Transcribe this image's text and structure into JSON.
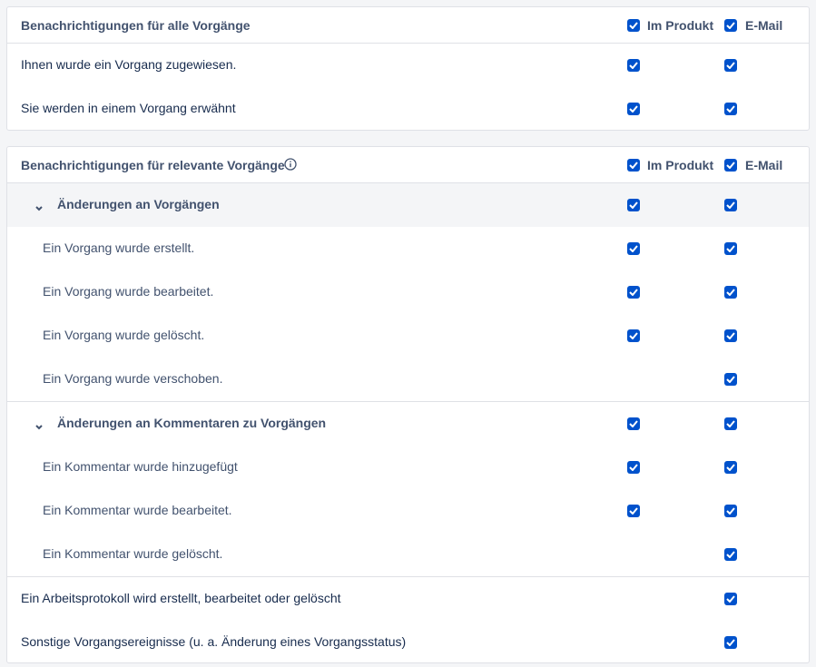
{
  "colors": {
    "accent": "#0052cc",
    "border": "#dfe1e6",
    "group_bg": "#f4f5f7"
  },
  "all_issues": {
    "title": "Benachrichtigungen für alle Vorgänge",
    "col_product": "Im Produkt",
    "col_email": "E-Mail",
    "rows": [
      {
        "label": "Ihnen wurde ein Vorgang zugewiesen.",
        "product": true,
        "email": true
      },
      {
        "label": "Sie werden in einem Vorgang erwähnt",
        "product": true,
        "email": true
      }
    ]
  },
  "relevant_issues": {
    "title": "Benachrichtigungen für relevante Vorgänge",
    "info_icon": "info-icon",
    "col_product": "Im Produkt",
    "col_email": "E-Mail",
    "groups": [
      {
        "label": "Änderungen an Vorgängen",
        "product": true,
        "email": true,
        "rows": [
          {
            "label": "Ein Vorgang wurde erstellt.",
            "product": true,
            "email": true
          },
          {
            "label": "Ein Vorgang wurde bearbeitet.",
            "product": true,
            "email": true
          },
          {
            "label": "Ein Vorgang wurde gelöscht.",
            "product": true,
            "email": true
          },
          {
            "label": "Ein Vorgang wurde verschoben.",
            "product": false,
            "email": true
          }
        ]
      },
      {
        "label": "Änderungen an Kommentaren zu Vorgängen",
        "product": true,
        "email": true,
        "rows": [
          {
            "label": "Ein Kommentar wurde hinzugefügt",
            "product": true,
            "email": true
          },
          {
            "label": "Ein Kommentar wurde bearbeitet.",
            "product": true,
            "email": true
          },
          {
            "label": "Ein Kommentar wurde gelöscht.",
            "product": false,
            "email": true
          }
        ]
      }
    ],
    "other_rows": [
      {
        "label": "Ein Arbeitsprotokoll wird erstellt, bearbeitet oder gelöscht",
        "product": false,
        "email": true
      },
      {
        "label": "Sonstige Vorgangsereignisse (u. a. Änderung eines Vorgangsstatus)",
        "product": false,
        "email": true
      }
    ]
  }
}
